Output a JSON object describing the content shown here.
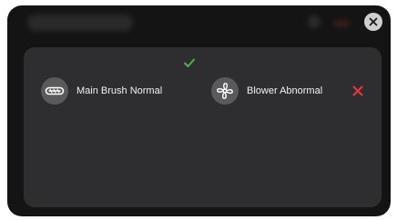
{
  "dialog": {
    "close_icon": "close-icon"
  },
  "components": [
    {
      "label": "Main Brush Normal",
      "icon": "main-brush-icon",
      "status": "normal",
      "status_icon": "check-icon",
      "status_color": "#4caf50"
    },
    {
      "label": "Blower Abnormal",
      "icon": "blower-fan-icon",
      "status": "abnormal",
      "status_icon": "cross-icon",
      "status_color": "#e53935"
    }
  ],
  "colors": {
    "dialog_background": "#141414",
    "panel_background": "#2e2e30",
    "icon_circle": "#5a5a5c",
    "text": "#f2f2f2"
  }
}
